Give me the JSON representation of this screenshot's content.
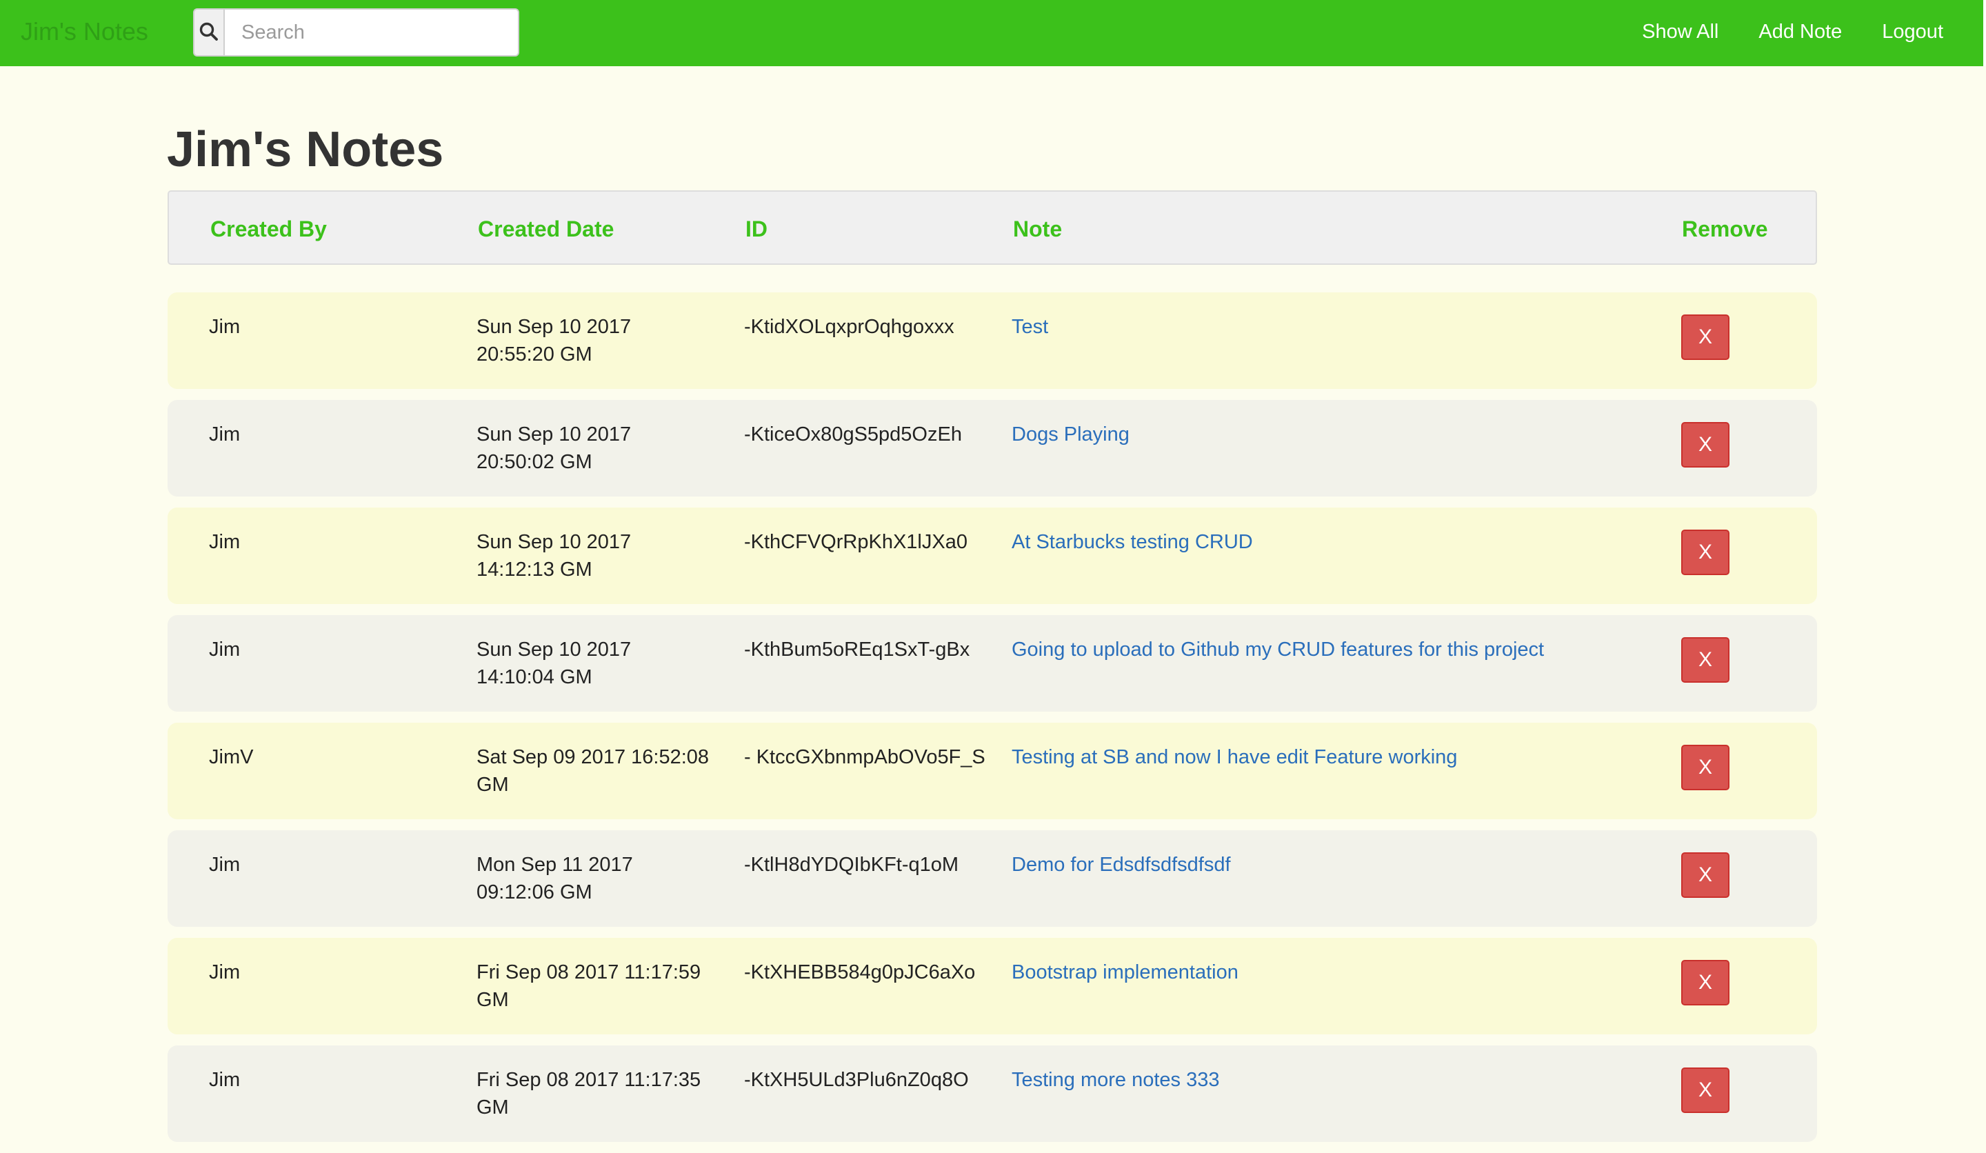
{
  "navbar": {
    "brand": "Jim's Notes",
    "search_placeholder": "Search",
    "search_value": "",
    "search_icon": "search-icon",
    "links": [
      "Show All",
      "Add Note",
      "Logout"
    ]
  },
  "colors": {
    "navbar": "#3cc11b",
    "header_text": "#3cc11b",
    "note_link": "#2a6ebb",
    "remove_button": "#d9534f",
    "row_odd": "#fafad6",
    "row_even": "#f2f2ea"
  },
  "page": {
    "title": "Jim's Notes"
  },
  "table": {
    "headers": {
      "created_by": "Created By",
      "created_date": "Created Date",
      "id": "ID",
      "note": "Note",
      "remove": "Remove"
    },
    "remove_label": "X",
    "rows": [
      {
        "created_by": "Jim",
        "created_date": "Sun Sep 10 2017 20:55:20 GM",
        "id": "-KtidXOLqxprOqhgoxxx",
        "note": "Test"
      },
      {
        "created_by": "Jim",
        "created_date": "Sun Sep 10 2017 20:50:02 GM",
        "id": "-KticeOx80gS5pd5OzEh",
        "note": "Dogs Playing"
      },
      {
        "created_by": "Jim",
        "created_date": "Sun Sep 10 2017 14:12:13 GM",
        "id": "-KthCFVQrRpKhX1lJXa0",
        "note": "At Starbucks testing CRUD"
      },
      {
        "created_by": "Jim",
        "created_date": "Sun Sep 10 2017 14:10:04 GM",
        "id": "-KthBum5oREq1SxT-gBx",
        "note": "Going to upload to Github my CRUD features for this project"
      },
      {
        "created_by": "JimV",
        "created_date": "Sat Sep 09 2017 16:52:08 GM",
        "id": "- KtccGXbnmpAbOVo5F_S",
        "note": "Testing at SB and now I have edit Feature working"
      },
      {
        "created_by": "Jim",
        "created_date": "Mon Sep 11 2017 09:12:06 GM",
        "id": "-KtlH8dYDQIbKFt-q1oM",
        "note": "Demo for Edsdfsdfsdfsdf"
      },
      {
        "created_by": "Jim",
        "created_date": "Fri Sep 08 2017 11:17:59 GM",
        "id": "-KtXHEBB584g0pJC6aXo",
        "note": "Bootstrap implementation"
      },
      {
        "created_by": "Jim",
        "created_date": "Fri Sep 08 2017 11:17:35 GM",
        "id": "-KtXH5ULd3Plu6nZ0q8O",
        "note": "Testing more notes 333"
      }
    ]
  }
}
